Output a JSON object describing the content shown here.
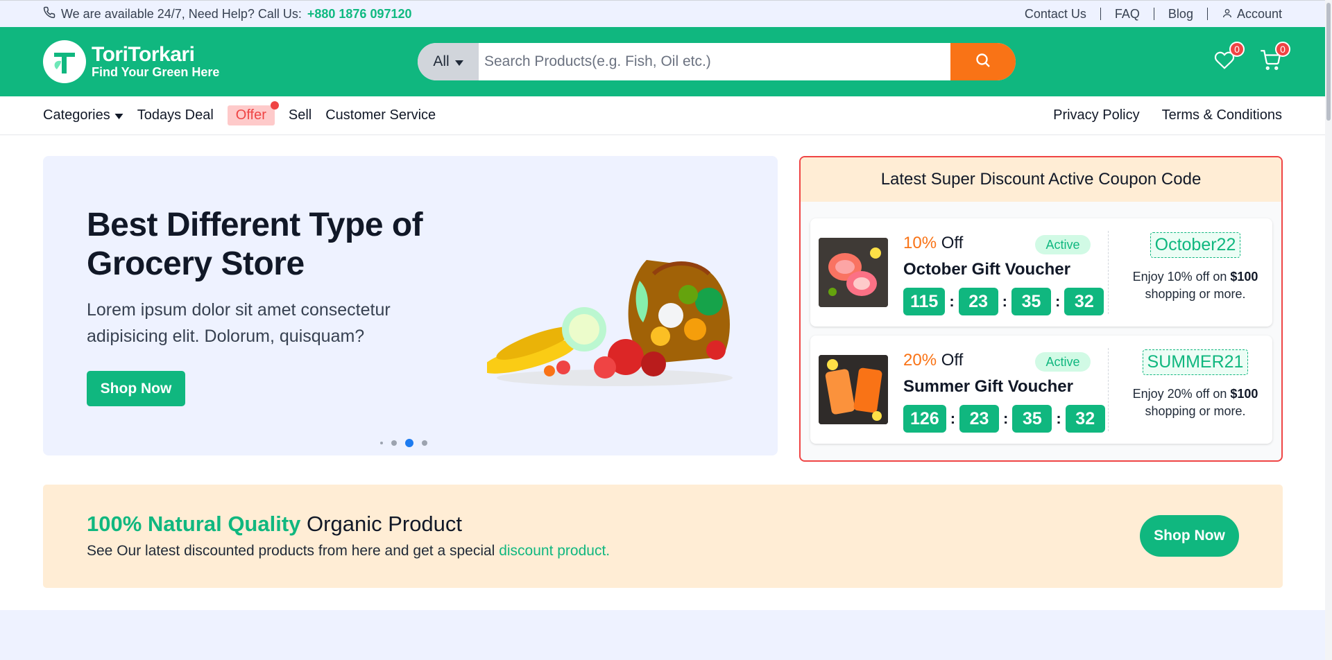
{
  "topbar": {
    "help_text": "We are available 24/7, Need Help? Call Us:",
    "phone": "+880 1876 097120",
    "links": [
      "Contact Us",
      "FAQ",
      "Blog",
      "Account"
    ]
  },
  "header": {
    "brand": "ToriTorkari",
    "tagline": "Find Your Green Here",
    "search": {
      "category": "All",
      "placeholder": "Search Products(e.g. Fish, Oil etc.)"
    },
    "wishlist_count": "0",
    "cart_count": "0"
  },
  "nav": {
    "left": [
      "Categories",
      "Todays Deal",
      "Offer",
      "Sell",
      "Customer Service"
    ],
    "right": [
      "Privacy Policy",
      "Terms & Conditions"
    ]
  },
  "hero": {
    "title": "Best Different Type of Grocery Store",
    "text": "Lorem ipsum dolor sit amet consectetur adipisicing elit. Dolorum, quisquam?",
    "button": "Shop Now",
    "active_slide": 3,
    "slide_count": 4
  },
  "coupon": {
    "heading": "Latest Super Discount Active Coupon Code",
    "items": [
      {
        "percent": "10%",
        "off": "Off",
        "status": "Active",
        "title": "October Gift Voucher",
        "timer": [
          "115",
          "23",
          "35",
          "32"
        ],
        "code": "October22",
        "desc_pre": "Enjoy 10% off on",
        "desc_amount": "$100",
        "desc_post": "shopping or more."
      },
      {
        "percent": "20%",
        "off": "Off",
        "status": "Active",
        "title": "Summer Gift Voucher",
        "timer": [
          "126",
          "23",
          "35",
          "32"
        ],
        "code": "SUMMER21",
        "desc_pre": "Enjoy 20% off on",
        "desc_amount": "$100",
        "desc_post": "shopping or more."
      }
    ]
  },
  "promo": {
    "highlight": "100% Natural Quality",
    "title_rest": "Organic Product",
    "text": "See Our latest discounted products from here and get a special",
    "link": "discount product.",
    "button": "Shop Now"
  },
  "colors": {
    "brand_green": "#10b77f",
    "accent_orange": "#f97316",
    "alert_red": "#ef4444",
    "hero_bg": "#eef2ff",
    "promo_bg": "#ffedd5"
  },
  "icons": [
    "phone-icon",
    "user-icon",
    "search-icon",
    "heart-icon",
    "cart-icon",
    "caret-down-icon"
  ]
}
